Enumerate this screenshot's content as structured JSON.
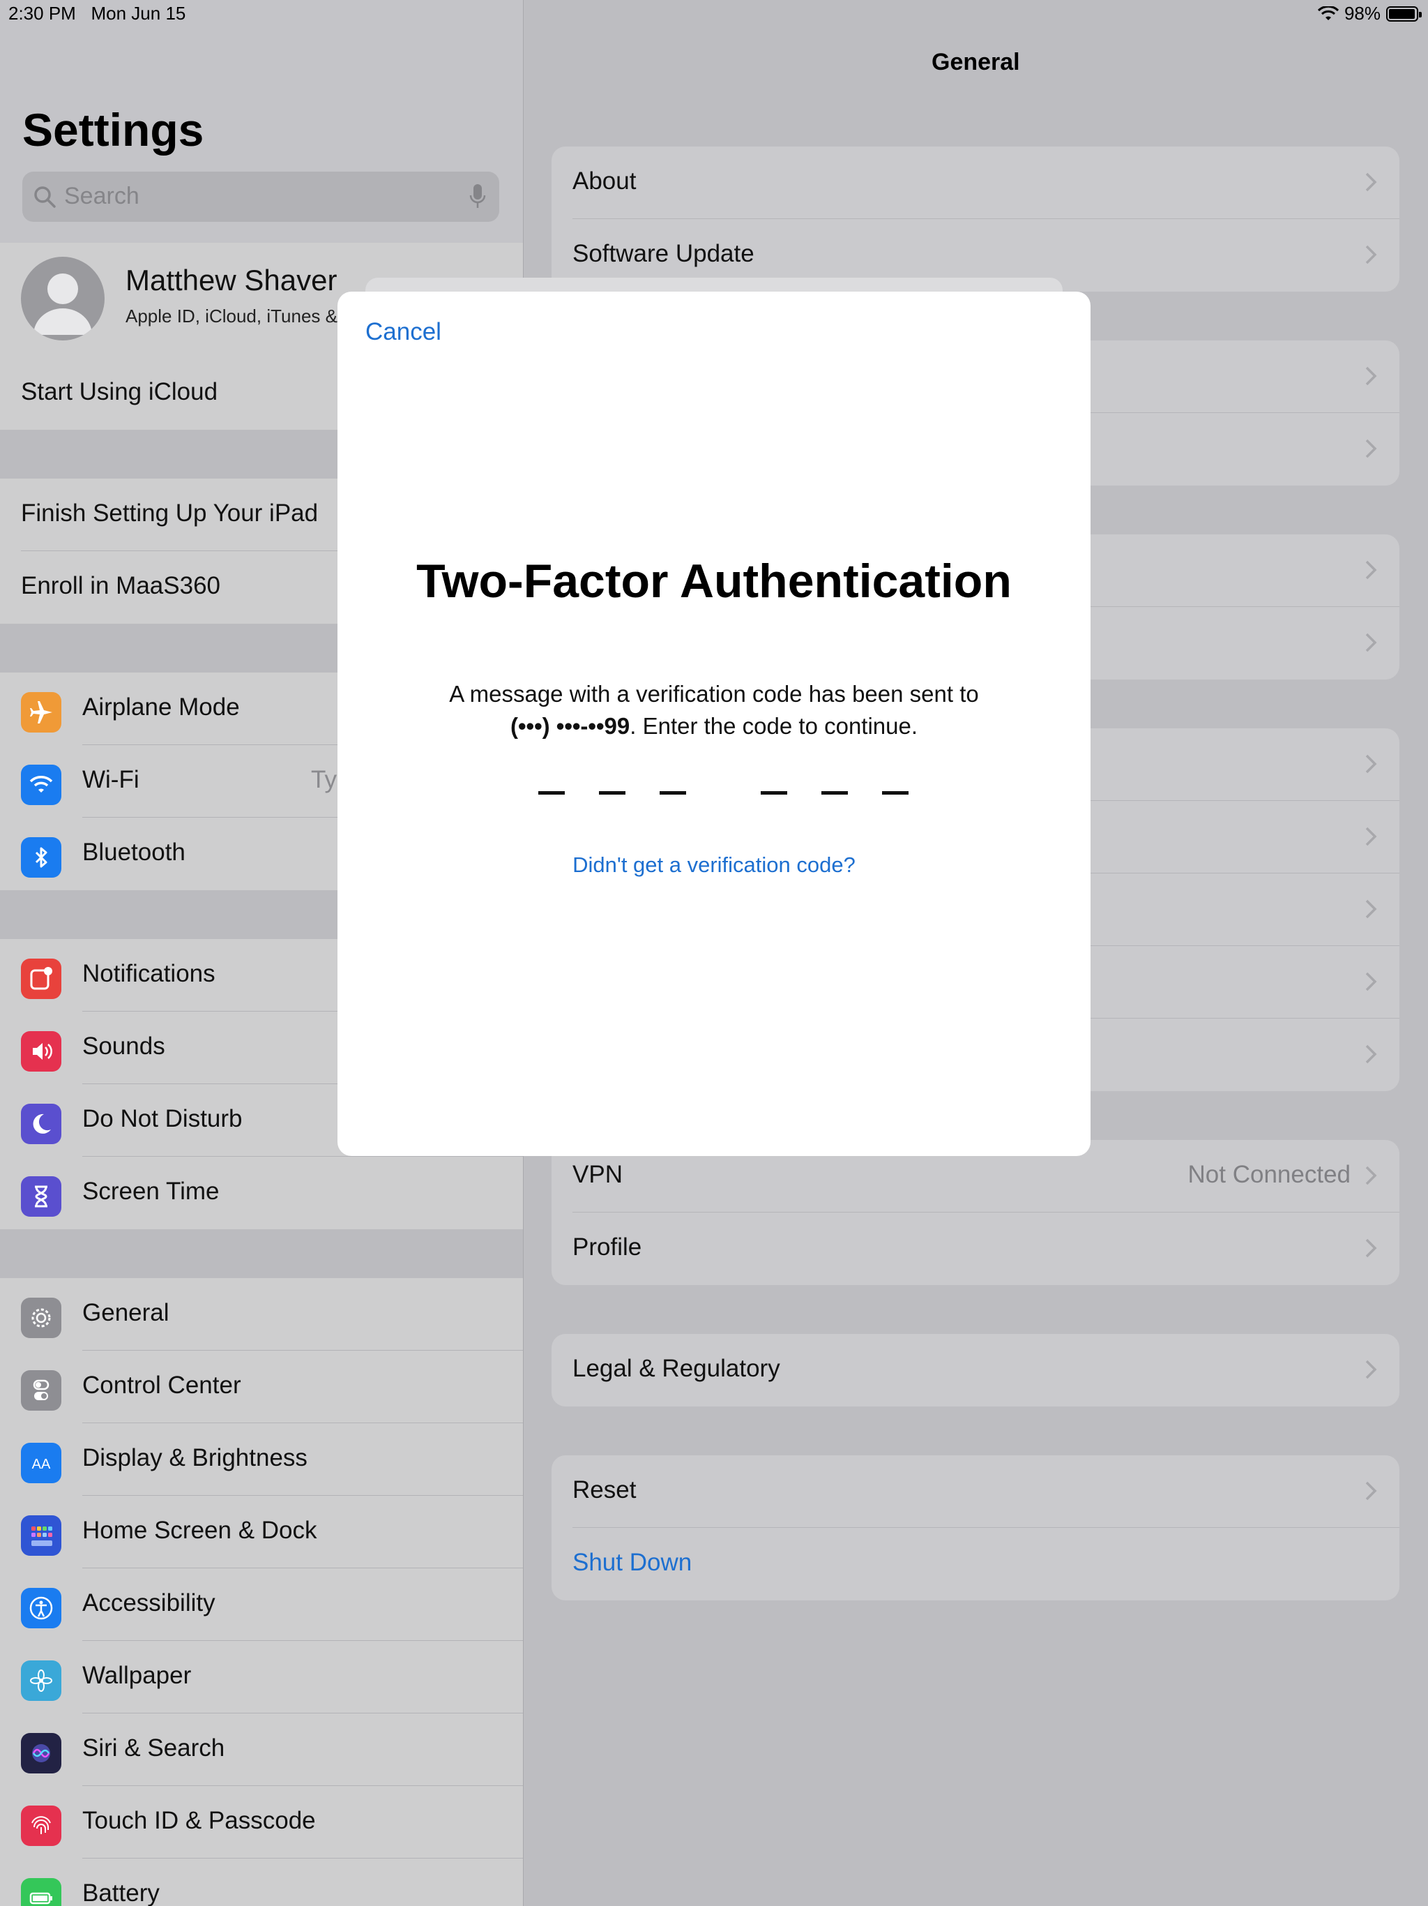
{
  "status_bar": {
    "time": "2:30 PM",
    "date": "Mon Jun 15",
    "battery_text": "98%",
    "battery_level": 0.98,
    "wifi_icon": "wifi-icon"
  },
  "sidebar": {
    "title": "Settings",
    "search_placeholder": "Search",
    "profile": {
      "name": "Matthew Shaver",
      "subtitle": "Apple ID, iCloud, iTunes &"
    },
    "start_icloud": "Start Using iCloud",
    "setup_items": [
      "Finish Setting Up Your iPad",
      "Enroll in MaaS360"
    ],
    "connectivity": [
      {
        "label": "Airplane Mode",
        "icon": "airplane-icon",
        "color": "#f09a37"
      },
      {
        "label": "Wi-Fi",
        "icon": "wifi-icon",
        "color": "#1a7cf0",
        "value": "Ty"
      },
      {
        "label": "Bluetooth",
        "icon": "bluetooth-icon",
        "color": "#1a7cf0"
      }
    ],
    "notifications_group": [
      {
        "label": "Notifications",
        "icon": "notifications-icon",
        "color": "#e8423c"
      },
      {
        "label": "Sounds",
        "icon": "sounds-icon",
        "color": "#e5314f"
      },
      {
        "label": "Do Not Disturb",
        "icon": "moon-icon",
        "color": "#5a4fcf"
      },
      {
        "label": "Screen Time",
        "icon": "hourglass-icon",
        "color": "#5a4fcf"
      }
    ],
    "general_group": [
      {
        "label": "General",
        "icon": "gear-icon",
        "color": "#8e8e93"
      },
      {
        "label": "Control Center",
        "icon": "toggles-icon",
        "color": "#8e8e93"
      },
      {
        "label": "Display & Brightness",
        "icon": "display-icon",
        "color": "#1a7cf0"
      },
      {
        "label": "Home Screen & Dock",
        "icon": "grid-icon",
        "color": "#2f55d4"
      },
      {
        "label": "Accessibility",
        "icon": "accessibility-icon",
        "color": "#1a7cf0"
      },
      {
        "label": "Wallpaper",
        "icon": "flower-icon",
        "color": "#3aa8d8"
      },
      {
        "label": "Siri & Search",
        "icon": "siri-icon",
        "color": "#222244"
      },
      {
        "label": "Touch ID & Passcode",
        "icon": "fingerprint-icon",
        "color": "#e5314f"
      },
      {
        "label": "Battery",
        "icon": "battery-icon",
        "color": "#34c759"
      }
    ]
  },
  "detail": {
    "title": "General",
    "group1": [
      "About",
      "Software Update"
    ],
    "vpn_group": [
      {
        "label": "VPN",
        "value": "Not Connected"
      },
      {
        "label": "Profile",
        "value": ""
      }
    ],
    "legal": "Legal & Regulatory",
    "reset": "Reset",
    "shutdown": "Shut Down"
  },
  "modal": {
    "cancel": "Cancel",
    "title": "Two-Factor Authentication",
    "message_line1": "A message with a verification code has been sent to",
    "phone_masked": "(•••) •••-••99",
    "message_line2_tail": ". Enter the code to continue.",
    "code_slot_count": 6,
    "resend": "Didn't get a verification code?"
  },
  "colors": {
    "accent": "#1d6fd0"
  }
}
